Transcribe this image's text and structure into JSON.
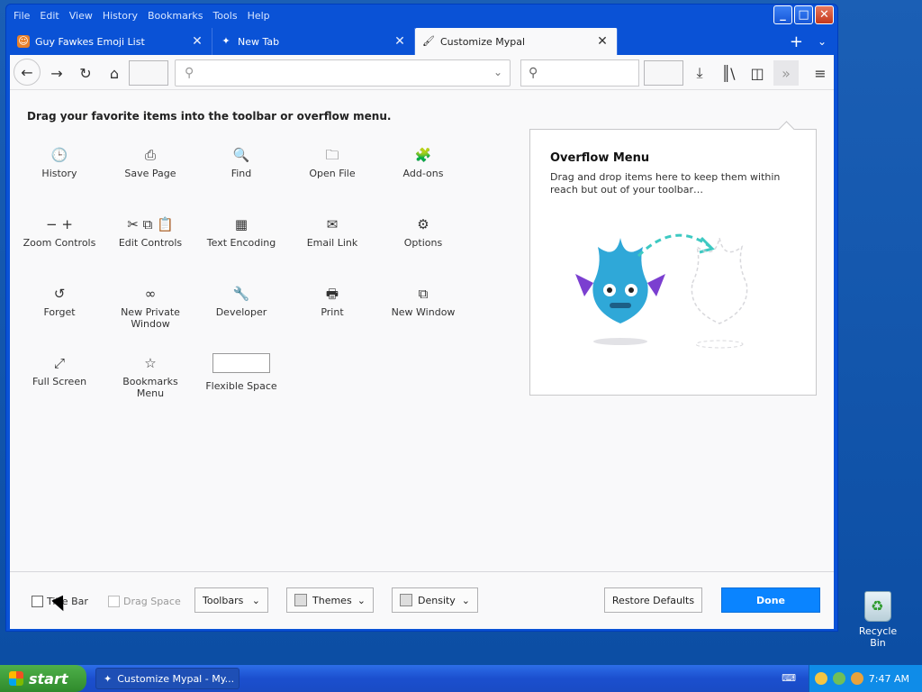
{
  "menu": [
    "File",
    "Edit",
    "View",
    "History",
    "Bookmarks",
    "Tools",
    "Help"
  ],
  "window_controls": {
    "minimize": "_",
    "maximize": "□",
    "close": "✕"
  },
  "tabs": [
    {
      "label": "Guy Fawkes Emoji List",
      "icon": "guy-fawkes-favicon",
      "active": false
    },
    {
      "label": "New Tab",
      "icon": "new-tab-favicon",
      "active": false
    },
    {
      "label": "Customize Mypal",
      "icon": "paintbrush-icon",
      "active": true
    }
  ],
  "tab_tools": {
    "new_tab": "+",
    "list_all": "⌄"
  },
  "nav": {
    "url_placeholder": "",
    "search_placeholder": ""
  },
  "palette": {
    "title": "Drag your favorite items into the toolbar or overflow menu.",
    "items": [
      {
        "label": "History",
        "icon": "🕒"
      },
      {
        "label": "Save Page",
        "icon": "⎙"
      },
      {
        "label": "Find",
        "icon": "🔍"
      },
      {
        "label": "Open File",
        "icon": "🗀"
      },
      {
        "label": "Add-ons",
        "icon": "🧩"
      },
      {
        "label": "Zoom Controls",
        "icon": "− +"
      },
      {
        "label": "Edit Controls",
        "icon": "✂ ⧉ 📋"
      },
      {
        "label": "Text Encoding",
        "icon": "▦"
      },
      {
        "label": "Email Link",
        "icon": "✉"
      },
      {
        "label": "Options",
        "icon": "⚙"
      },
      {
        "label": "Forget",
        "icon": "↺"
      },
      {
        "label": "New Private Window",
        "icon": "∞"
      },
      {
        "label": "Developer",
        "icon": "🔧"
      },
      {
        "label": "Print",
        "icon": "🖶"
      },
      {
        "label": "New Window",
        "icon": "⧉"
      },
      {
        "label": "Full Screen",
        "icon": "⤢"
      },
      {
        "label": "Bookmarks Menu",
        "icon": "☆"
      },
      {
        "label": "Flexible Space",
        "icon": ""
      }
    ]
  },
  "overflow": {
    "title": "Overflow Menu",
    "description": "Drag and drop items here to keep them within reach but out of your toolbar…"
  },
  "footer": {
    "title_bar": "Title Bar",
    "drag_space": "Drag Space",
    "toolbars": "Toolbars",
    "themes": "Themes",
    "density": "Density",
    "restore_defaults": "Restore Defaults",
    "done": "Done"
  },
  "desktop": {
    "recycle_bin": "Recycle Bin"
  },
  "taskbar": {
    "start": "start",
    "item": "Customize Mypal - My...",
    "clock": "7:47 AM"
  },
  "colors": {
    "accent": "#0a84ff",
    "titlebar": "#0a52d6",
    "taskbar": "#1b4fce"
  }
}
